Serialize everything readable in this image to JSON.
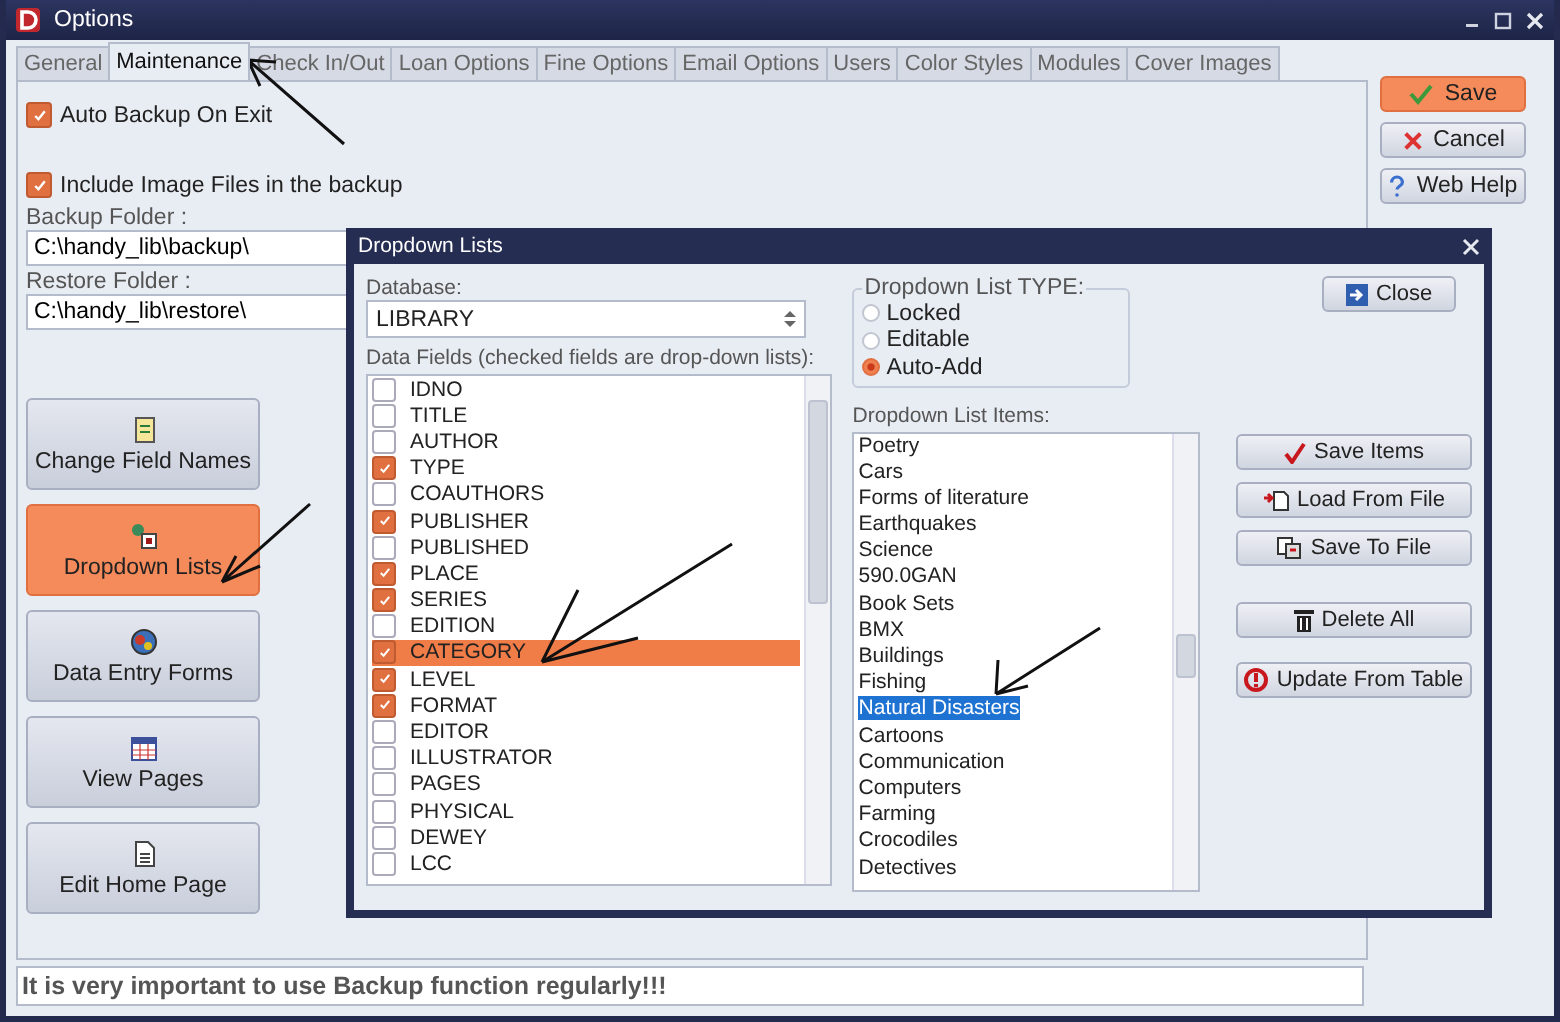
{
  "window": {
    "title": "Options"
  },
  "tabs": [
    {
      "label": "General",
      "selected": false
    },
    {
      "label": "Maintenance",
      "selected": true
    },
    {
      "label": "Check In/Out",
      "selected": false
    },
    {
      "label": "Loan Options",
      "selected": false
    },
    {
      "label": "Fine Options",
      "selected": false
    },
    {
      "label": "Email Options",
      "selected": false
    },
    {
      "label": "Users",
      "selected": false
    },
    {
      "label": "Color Styles",
      "selected": false
    },
    {
      "label": "Modules",
      "selected": false
    },
    {
      "label": "Cover Images",
      "selected": false
    }
  ],
  "options": [
    {
      "label": "Auto Backup On Exit",
      "checked": true
    },
    {
      "label": "Include Image Files in the backup",
      "checked": true
    }
  ],
  "folders": [
    {
      "label": "Backup Folder :",
      "value": "C:\\handy_lib\\backup\\"
    },
    {
      "label": "Restore Folder :",
      "value": "C:\\handy_lib\\restore\\"
    }
  ],
  "side_buttons": [
    {
      "label": "Change Field Names",
      "selected": false
    },
    {
      "label": "Dropdown Lists",
      "selected": true
    },
    {
      "label": "Data Entry Forms",
      "selected": false
    },
    {
      "label": "View Pages",
      "selected": false
    },
    {
      "label": "Edit Home Page",
      "selected": false
    }
  ],
  "status_bar": "It is very important to use Backup function regularly!!!",
  "action_buttons": [
    {
      "label": "Save",
      "highlighted": true
    },
    {
      "label": "Cancel",
      "highlighted": false
    },
    {
      "label": "Web Help",
      "highlighted": false
    }
  ],
  "dialog": {
    "title": "Dropdown Lists",
    "database_label": "Database:",
    "database": "LIBRARY",
    "fields_label": "Data Fields (checked fields are drop-down lists):",
    "fields": [
      {
        "name": "IDNO",
        "checked": false,
        "selected": false
      },
      {
        "name": "TITLE",
        "checked": false,
        "selected": false
      },
      {
        "name": "AUTHOR",
        "checked": false,
        "selected": false
      },
      {
        "name": "TYPE",
        "checked": true,
        "selected": false
      },
      {
        "name": "COAUTHORS",
        "checked": false,
        "selected": false
      },
      {
        "name": "PUBLISHER",
        "checked": true,
        "selected": false
      },
      {
        "name": "PUBLISHED",
        "checked": false,
        "selected": false
      },
      {
        "name": "PLACE",
        "checked": true,
        "selected": false
      },
      {
        "name": "SERIES",
        "checked": true,
        "selected": false
      },
      {
        "name": "EDITION",
        "checked": false,
        "selected": false
      },
      {
        "name": "CATEGORY",
        "checked": true,
        "selected": true
      },
      {
        "name": "LEVEL",
        "checked": true,
        "selected": false
      },
      {
        "name": "FORMAT",
        "checked": true,
        "selected": false
      },
      {
        "name": "EDITOR",
        "checked": false,
        "selected": false
      },
      {
        "name": "ILLUSTRATOR",
        "checked": false,
        "selected": false
      },
      {
        "name": "PAGES",
        "checked": false,
        "selected": false
      },
      {
        "name": "PHYSICAL",
        "checked": false,
        "selected": false
      },
      {
        "name": "DEWEY",
        "checked": false,
        "selected": false
      },
      {
        "name": "LCC",
        "checked": false,
        "selected": false
      }
    ],
    "type_label": "Dropdown List TYPE:",
    "types": [
      {
        "label": "Locked",
        "selected": false
      },
      {
        "label": "Editable",
        "selected": false
      },
      {
        "label": "Auto-Add",
        "selected": true
      }
    ],
    "close_button": "Close",
    "items_label": "Dropdown List Items:",
    "items": [
      {
        "text": "Poetry",
        "selected": false
      },
      {
        "text": "Cars",
        "selected": false
      },
      {
        "text": "Forms of literature",
        "selected": false
      },
      {
        "text": "Earthquakes",
        "selected": false
      },
      {
        "text": "Science",
        "selected": false
      },
      {
        "text": "590.0GAN",
        "selected": false
      },
      {
        "text": "Book Sets",
        "selected": false
      },
      {
        "text": "BMX",
        "selected": false
      },
      {
        "text": "Buildings",
        "selected": false
      },
      {
        "text": "Fishing",
        "selected": false
      },
      {
        "text": "Natural Disasters",
        "selected": true
      },
      {
        "text": "Cartoons",
        "selected": false
      },
      {
        "text": "Communication",
        "selected": false
      },
      {
        "text": "Computers",
        "selected": false
      },
      {
        "text": "Farming",
        "selected": false
      },
      {
        "text": "Crocodiles",
        "selected": false
      },
      {
        "text": "Detectives",
        "selected": false
      }
    ],
    "item_buttons": [
      {
        "label": "Save Items"
      },
      {
        "label": "Load From File"
      },
      {
        "label": "Save To File"
      },
      {
        "label": "Delete All"
      },
      {
        "label": "Update From Table"
      }
    ]
  }
}
